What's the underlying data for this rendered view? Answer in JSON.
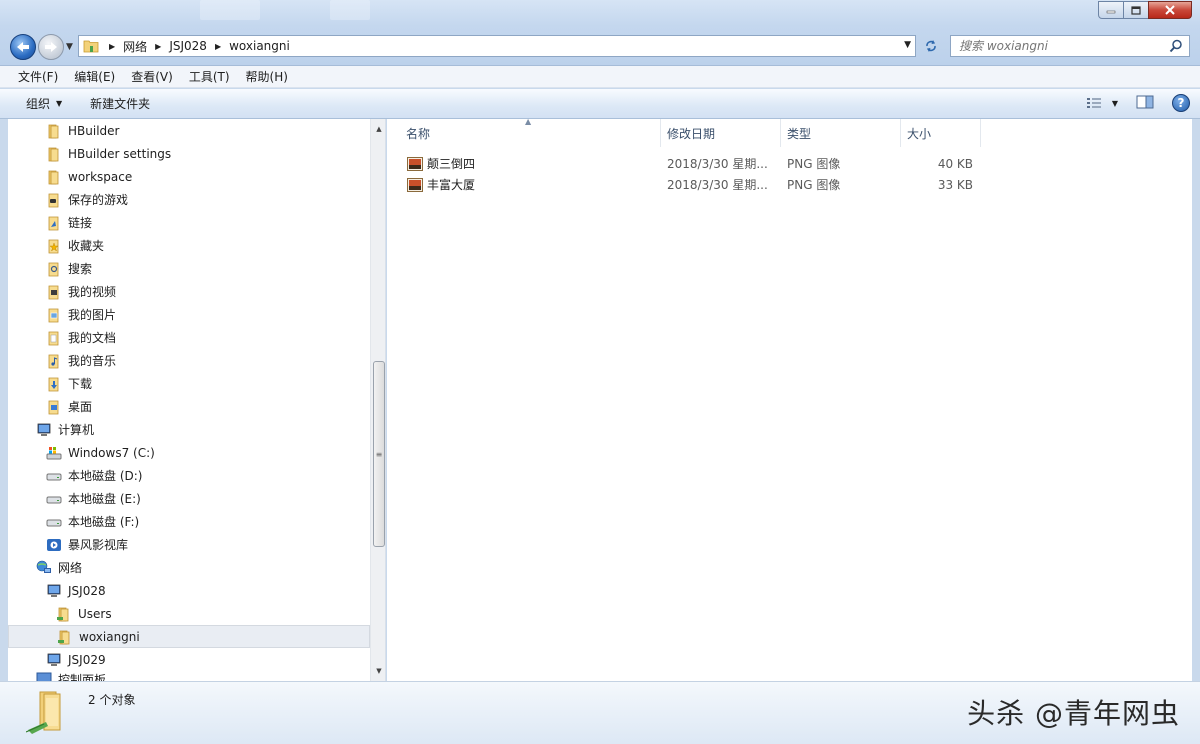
{
  "window": {
    "controls": {
      "minimize": "minimize-icon",
      "maximize": "maximize-icon",
      "close": "close-icon"
    }
  },
  "address": {
    "crumbs": [
      "网络",
      "JSJ028",
      "woxiangni"
    ]
  },
  "search": {
    "placeholder": "搜索 woxiangni"
  },
  "menu": [
    "文件(F)",
    "编辑(E)",
    "查看(V)",
    "工具(T)",
    "帮助(H)"
  ],
  "toolbar": {
    "organize": "组织",
    "new_folder": "新建文件夹",
    "help": "?"
  },
  "nav": {
    "items": [
      {
        "label": "HBuilder",
        "icon": "folder-icon",
        "level": 1
      },
      {
        "label": "HBuilder settings",
        "icon": "folder-icon",
        "level": 1
      },
      {
        "label": "workspace",
        "icon": "folder-icon",
        "level": 1
      },
      {
        "label": "保存的游戏",
        "icon": "saved-games-icon",
        "level": 1
      },
      {
        "label": "链接",
        "icon": "links-icon",
        "level": 1
      },
      {
        "label": "收藏夹",
        "icon": "favorites-icon",
        "level": 1
      },
      {
        "label": "搜索",
        "icon": "searches-icon",
        "level": 1
      },
      {
        "label": "我的视频",
        "icon": "videos-icon",
        "level": 1
      },
      {
        "label": "我的图片",
        "icon": "pictures-icon",
        "level": 1
      },
      {
        "label": "我的文档",
        "icon": "documents-icon",
        "level": 1
      },
      {
        "label": "我的音乐",
        "icon": "music-icon",
        "level": 1
      },
      {
        "label": "下载",
        "icon": "downloads-icon",
        "level": 1
      },
      {
        "label": "桌面",
        "icon": "desktop-icon",
        "level": 1
      },
      {
        "label": "计算机",
        "icon": "computer-icon",
        "level": 0
      },
      {
        "label": "Windows7 (C:)",
        "icon": "system-drive-icon",
        "level": 1
      },
      {
        "label": "本地磁盘 (D:)",
        "icon": "drive-icon",
        "level": 1
      },
      {
        "label": "本地磁盘 (E:)",
        "icon": "drive-icon",
        "level": 1
      },
      {
        "label": "本地磁盘 (F:)",
        "icon": "drive-icon",
        "level": 1
      },
      {
        "label": "暴风影视库",
        "icon": "media-library-icon",
        "level": 1
      },
      {
        "label": "网络",
        "icon": "network-icon",
        "level": 0
      },
      {
        "label": "JSJ028",
        "icon": "computer-icon",
        "level": 1
      },
      {
        "label": "Users",
        "icon": "shared-folder-icon",
        "level": 2
      },
      {
        "label": "woxiangni",
        "icon": "shared-folder-icon",
        "level": 2,
        "selected": true
      },
      {
        "label": "JSJ029",
        "icon": "computer-icon",
        "level": 1
      },
      {
        "label": "控制面板",
        "icon": "control-panel-icon",
        "level": 0,
        "cut": true
      }
    ]
  },
  "files": {
    "columns": [
      "名称",
      "修改日期",
      "类型",
      "大小"
    ],
    "rows": [
      {
        "name": "颠三倒四",
        "date": "2018/3/30 星期...",
        "type": "PNG 图像",
        "size": "40 KB"
      },
      {
        "name": "丰富大厦",
        "date": "2018/3/30 星期...",
        "type": "PNG 图像",
        "size": "33 KB"
      }
    ]
  },
  "status": {
    "count": "2 个对象"
  },
  "watermark": "头杀 @青年网虫",
  "colors": {
    "chrome": "#c4d7ee",
    "accent": "#2b6cc2",
    "selection": "#e9edf3"
  }
}
